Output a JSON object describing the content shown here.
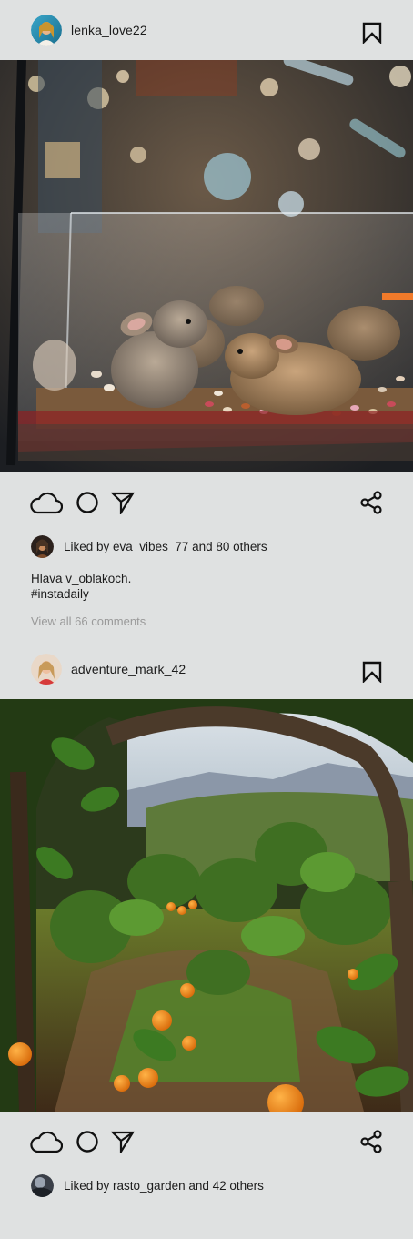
{
  "posts": [
    {
      "username": "lenka_love22",
      "likes_text": "Liked by eva_vibes_77 and 80 others",
      "caption": "Hlava v_oblakoch.",
      "hashtag": "#instadaily",
      "comments_link": "View all 66 comments"
    },
    {
      "username": "adventure_mark_42",
      "likes_text": "Liked by rasto_garden and 42 others"
    }
  ],
  "icons": {
    "bookmark": "bookmark-icon",
    "like": "cloud-icon",
    "comment": "circle-icon",
    "send": "send-icon",
    "share": "share-icon"
  }
}
